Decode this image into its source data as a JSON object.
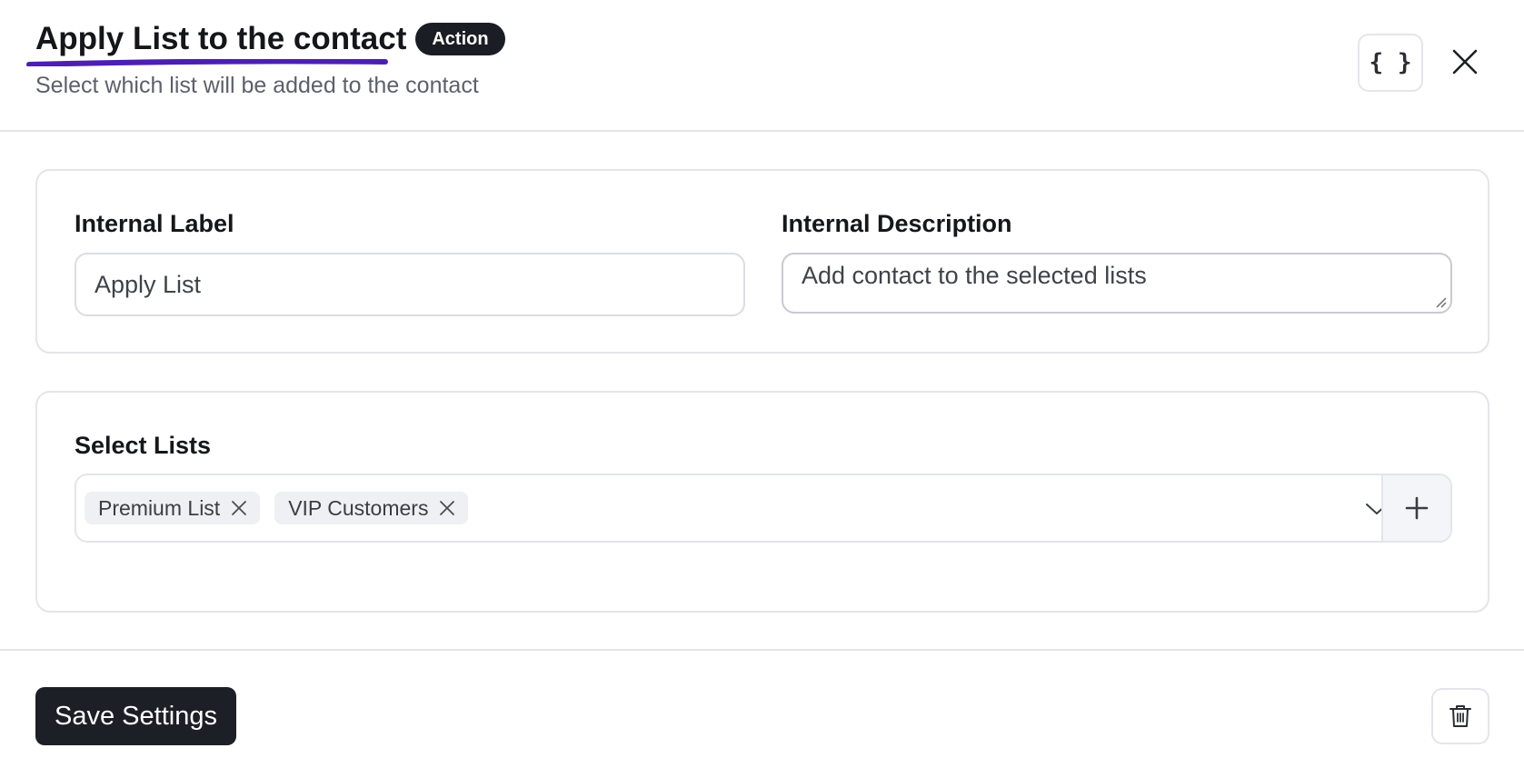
{
  "header": {
    "title": "Apply List to the contact",
    "badge": "Action",
    "subtitle": "Select which list will be added to the contact",
    "code_button": "{ }"
  },
  "settings": {
    "internal_label": {
      "label": "Internal Label",
      "value": "Apply List"
    },
    "internal_description": {
      "label": "Internal Description",
      "value": "Add contact to the selected lists"
    }
  },
  "lists": {
    "label": "Select Lists",
    "selected": [
      "Premium List",
      "VIP Customers"
    ]
  },
  "footer": {
    "save_label": "Save Settings"
  },
  "colors": {
    "accent_underline": "#4c1fb2",
    "primary_button": "#1d1f27",
    "badge": "#1b1d24"
  },
  "icons": {
    "close": "close-icon",
    "code": "code-braces-icon",
    "remove_tag": "x-icon",
    "dropdown": "chevron-down-icon",
    "add": "plus-icon",
    "delete": "trash-icon"
  }
}
